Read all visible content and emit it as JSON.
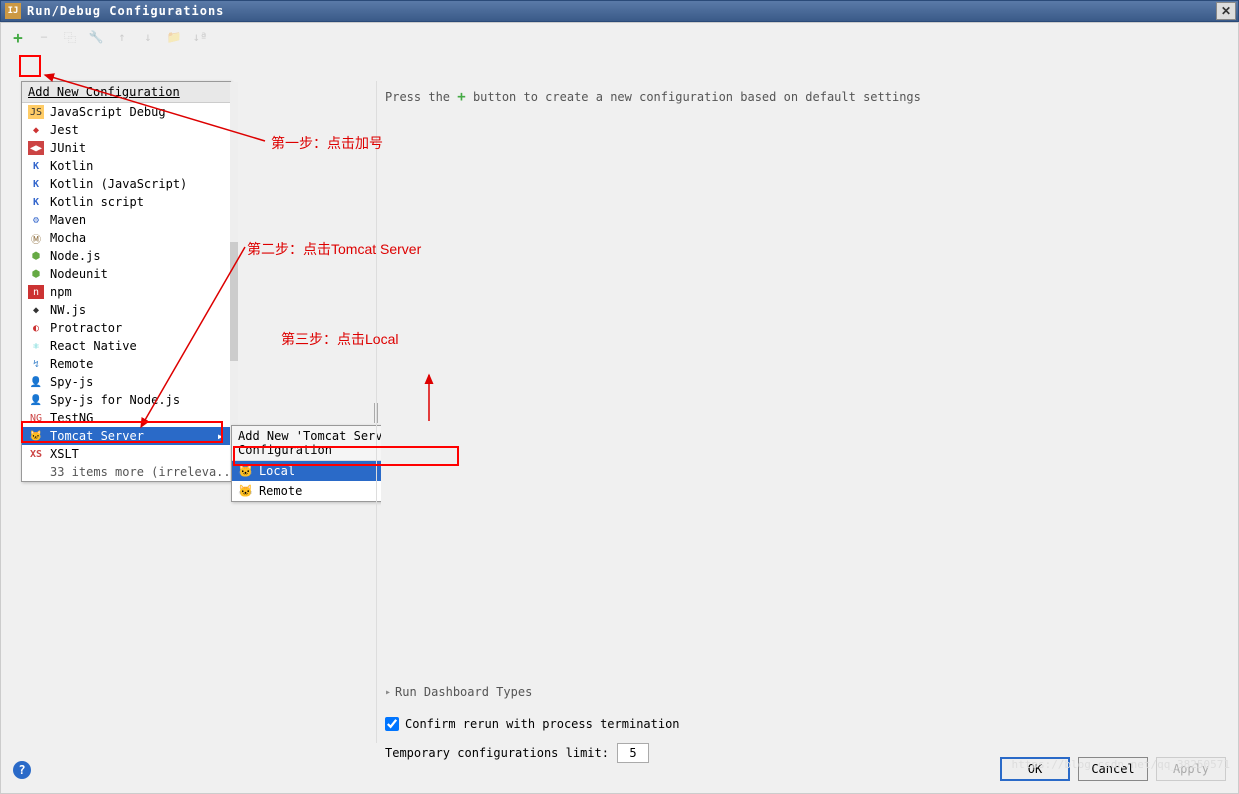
{
  "window": {
    "title": "Run/Debug Configurations",
    "close": "✕"
  },
  "toolbar": {
    "add": "+",
    "remove": "−",
    "copy": "⿻",
    "wrench": "🔧",
    "up": "↑",
    "down": "↓",
    "folder": "📁",
    "sort": "↓ª"
  },
  "menu1": {
    "header": "Add New Configuration",
    "items": [
      {
        "icon": "ic-js",
        "glyph": "JS",
        "label": "JavaScript Debug"
      },
      {
        "icon": "ic-jest",
        "glyph": "◆",
        "label": "Jest"
      },
      {
        "icon": "ic-junit",
        "glyph": "◀▶",
        "label": "JUnit"
      },
      {
        "icon": "ic-kotlin",
        "glyph": "K",
        "label": "Kotlin"
      },
      {
        "icon": "ic-kotlin",
        "glyph": "K",
        "label": "Kotlin (JavaScript)"
      },
      {
        "icon": "ic-kotlin",
        "glyph": "K",
        "label": "Kotlin script"
      },
      {
        "icon": "ic-maven",
        "glyph": "⚙",
        "label": "Maven"
      },
      {
        "icon": "ic-mocha",
        "glyph": "Ⓜ",
        "label": "Mocha"
      },
      {
        "icon": "ic-node",
        "glyph": "⬢",
        "label": "Node.js"
      },
      {
        "icon": "ic-node",
        "glyph": "⬢",
        "label": "Nodeunit"
      },
      {
        "icon": "ic-npm",
        "glyph": "n",
        "label": "npm"
      },
      {
        "icon": "ic-nw",
        "glyph": "◆",
        "label": "NW.js"
      },
      {
        "icon": "ic-prot",
        "glyph": "◐",
        "label": "Protractor"
      },
      {
        "icon": "ic-react",
        "glyph": "⚛",
        "label": "React Native"
      },
      {
        "icon": "ic-remote",
        "glyph": "↯",
        "label": "Remote"
      },
      {
        "icon": "ic-spy",
        "glyph": "👤",
        "label": "Spy-js"
      },
      {
        "icon": "ic-spy",
        "glyph": "👤",
        "label": "Spy-js for Node.js"
      },
      {
        "icon": "ic-testng",
        "glyph": "NG",
        "label": "TestNG"
      },
      {
        "icon": "ic-tomcat",
        "glyph": "🐱",
        "label": "Tomcat Server",
        "selected": true,
        "hasSubmenu": true
      },
      {
        "icon": "ic-xslt",
        "glyph": "XS",
        "label": "XSLT"
      }
    ],
    "more": "33 items more (irreleva..."
  },
  "menu2": {
    "header": "Add New 'Tomcat Server' Configuration",
    "items": [
      {
        "icon": "ic-tomcat",
        "glyph": "🐱",
        "label": "Local",
        "selected": true
      },
      {
        "icon": "ic-tomcat",
        "glyph": "🐱",
        "label": "Remote"
      }
    ]
  },
  "rightPanel": {
    "hint_before": "Press the",
    "hint_plus": "+",
    "hint_after": "button to create a new configuration based on default settings"
  },
  "annotations": {
    "step1": "第一步：点击加号",
    "step2": "第二步：点击Tomcat Server",
    "step3": "第三步：点击Local"
  },
  "dashboard": {
    "title": "Run Dashboard Types"
  },
  "confirm": {
    "label": "Confirm rerun with process termination",
    "checked": true
  },
  "limit": {
    "label": "Temporary configurations limit:",
    "value": "5"
  },
  "buttons": {
    "ok": "OK",
    "cancel": "Cancel",
    "apply": "Apply"
  },
  "watermark": "https://blog.csdn.net/qq_38250571"
}
